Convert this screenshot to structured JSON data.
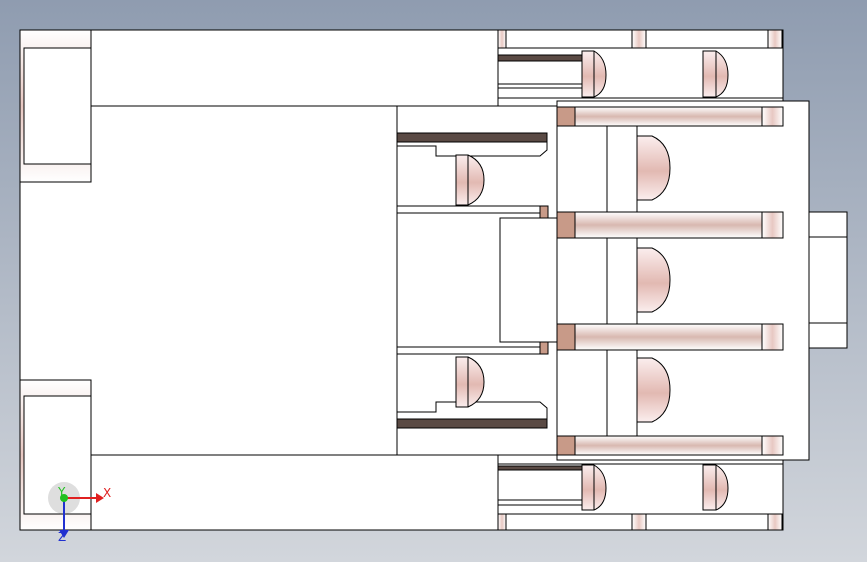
{
  "view": {
    "kind": "cad-orthographic-view",
    "background_top": "#8f9cb0",
    "background_bottom": "#d2d6dc"
  },
  "colors": {
    "edge": "#000000",
    "face": "#ffffff",
    "pink_shade": "#e6c6c0",
    "copper": "#c89a88",
    "dark_plate": "#5a4a44"
  },
  "triad": {
    "x_label": "X",
    "y_label": "Y",
    "z_label": "Z",
    "x_color": "#e02020",
    "y_color": "#20c020",
    "z_color": "#2030d0"
  }
}
